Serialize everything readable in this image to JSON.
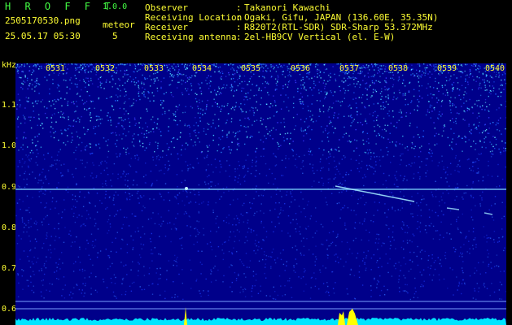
{
  "header": {
    "logo": "H R O F F T",
    "version": "1.0.0",
    "filename": "2505170530.png",
    "datetime": "25.05.17 05:30",
    "meteor_label": "meteor",
    "meteor_count": "5"
  },
  "info": [
    {
      "label": "Observer",
      "value": "Takanori Kawachi"
    },
    {
      "label": "Receiving Location",
      "value": "Ogaki, Gifu, JAPAN (136.60E, 35.35N)"
    },
    {
      "label": "Receiver",
      "value": "R820T2(RTL-SDR) SDR-Sharp 53.372MHz"
    },
    {
      "label": "Receiving antenna",
      "value": "2el-HB9CV Vertical (el. E-W)"
    }
  ],
  "axis": {
    "unit": "kHz",
    "freq_labels": [
      "1.1",
      "1.0",
      "0.9",
      "0.8",
      "0.7",
      "0.6"
    ],
    "time_labels": [
      "0531",
      "0532",
      "0533",
      "0534",
      "0535",
      "0536",
      "0537",
      "0538",
      "0539",
      "0540"
    ]
  },
  "colors": {
    "text_yellow": "#ffff33",
    "text_green": "#44ff44",
    "background": "#000000",
    "spectrum_bg": "#00008a",
    "noise_cyan": "#00e5ff",
    "meteor_yellow": "#ffff00"
  }
}
